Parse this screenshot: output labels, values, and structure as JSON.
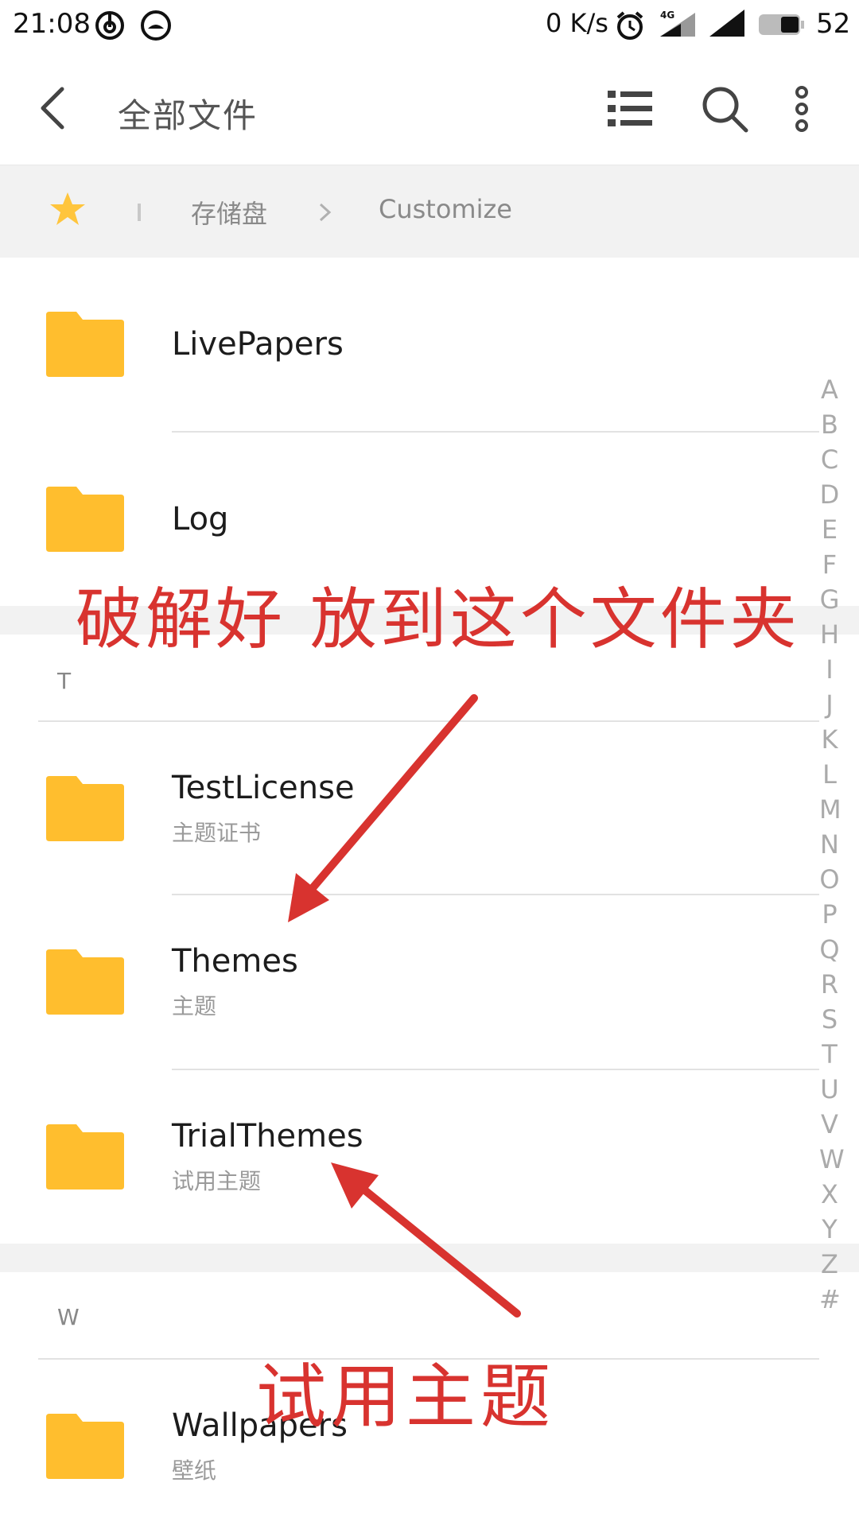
{
  "status_bar": {
    "time": "21:08",
    "net_speed": "0 K/s",
    "network_type": "4G",
    "battery_level": "52",
    "icons": [
      "netease-music-icon",
      "app-icon",
      "alarm-icon",
      "signal-4g-icon",
      "signal-icon",
      "battery-icon"
    ]
  },
  "toolbar": {
    "title": "全部文件",
    "icons": [
      "back-icon",
      "list-view-icon",
      "search-icon",
      "more-icon"
    ]
  },
  "breadcrumb": {
    "items": [
      "存储盘",
      "Customize"
    ]
  },
  "list": {
    "items": [
      {
        "name": "LivePapers",
        "subtitle": ""
      },
      {
        "name": "Log",
        "subtitle": ""
      },
      {
        "name": "TestLicense",
        "subtitle": "主题证书"
      },
      {
        "name": "Themes",
        "subtitle": "主题"
      },
      {
        "name": "TrialThemes",
        "subtitle": "试用主题"
      },
      {
        "name": "Wallpapers",
        "subtitle": "壁纸"
      }
    ],
    "sections": [
      "T",
      "W"
    ]
  },
  "alphabet_index": [
    "A",
    "B",
    "C",
    "D",
    "E",
    "F",
    "G",
    "H",
    "I",
    "J",
    "K",
    "L",
    "M",
    "N",
    "O",
    "P",
    "Q",
    "R",
    "S",
    "T",
    "U",
    "V",
    "W",
    "X",
    "Y",
    "Z",
    "#"
  ],
  "annotations": {
    "main": "破解好 放到这个文件夹",
    "bottom": "试用主题"
  },
  "colors": {
    "folder": "#FFBE2E",
    "star": "#FFC53D",
    "annotation": "#D8332F",
    "breadcrumb_bg": "#F2F2F2"
  }
}
